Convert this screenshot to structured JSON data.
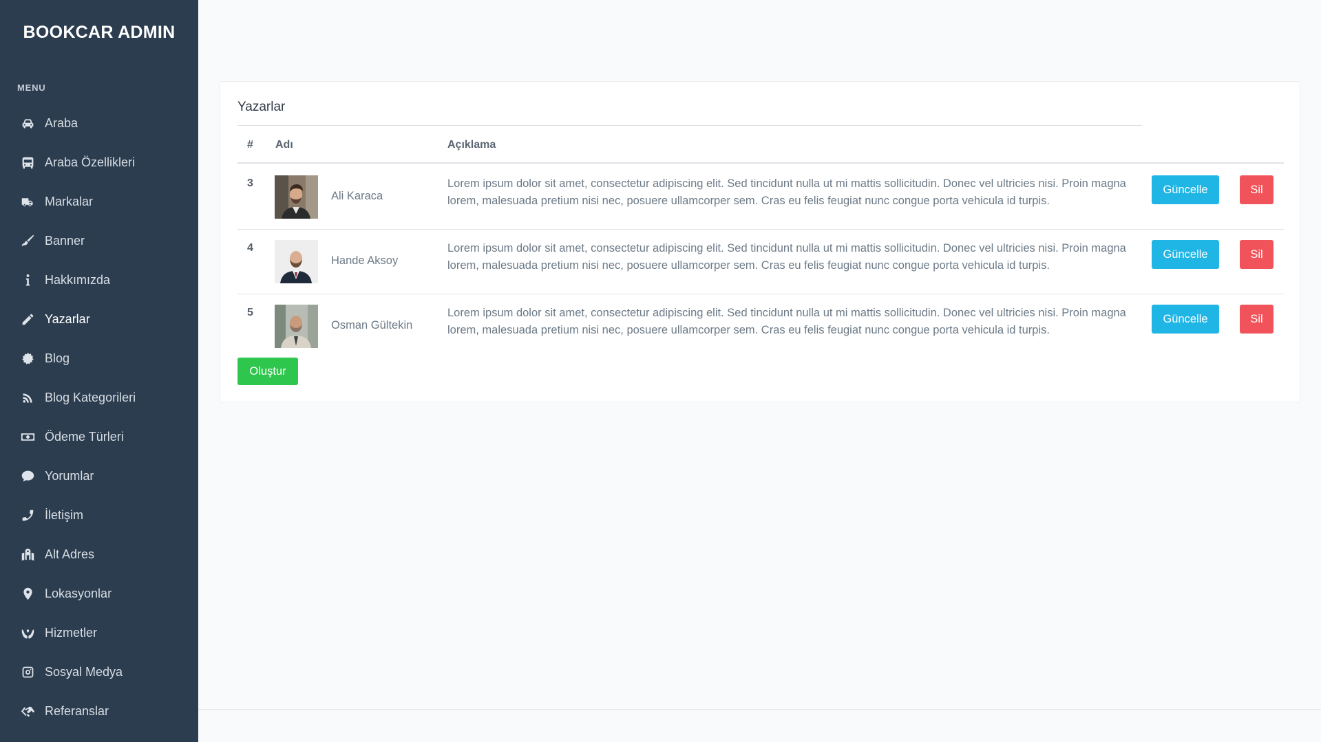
{
  "brand": "BOOKCAR ADMIN",
  "menu_title": "MENU",
  "menu": [
    {
      "label": "Araba",
      "icon": "car-icon"
    },
    {
      "label": "Araba Özellikleri",
      "icon": "bus-icon"
    },
    {
      "label": "Markalar",
      "icon": "truck-icon"
    },
    {
      "label": "Banner",
      "icon": "paint-brush-icon"
    },
    {
      "label": "Hakkımızda",
      "icon": "info-icon"
    },
    {
      "label": "Yazarlar",
      "icon": "pencil-icon",
      "active": true
    },
    {
      "label": "Blog",
      "icon": "gear-badge-icon"
    },
    {
      "label": "Blog Kategorileri",
      "icon": "feed-icon"
    },
    {
      "label": "Ödeme Türleri",
      "icon": "money-icon"
    },
    {
      "label": "Yorumlar",
      "icon": "comment-icon"
    },
    {
      "label": "İletişim",
      "icon": "phone-icon"
    },
    {
      "label": "Alt Adres",
      "icon": "map-icon"
    },
    {
      "label": "Lokasyonlar",
      "icon": "map-marker-icon"
    },
    {
      "label": "Hizmetler",
      "icon": "hands-icon"
    },
    {
      "label": "Sosyal Medya",
      "icon": "instagram-icon"
    },
    {
      "label": "Referanslar",
      "icon": "handshake-icon"
    }
  ],
  "card": {
    "title": "Yazarlar",
    "columns": {
      "num": "#",
      "name": "Adı",
      "desc": "Açıklama"
    },
    "rows": [
      {
        "id": "3",
        "name": "Ali Karaca",
        "description": "Lorem ipsum dolor sit amet, consectetur adipiscing elit. Sed tincidunt nulla ut mi mattis sollicitudin. Donec vel ultricies nisi. Proin magna lorem, malesuada pretium nisi nec, posuere ullamcorper sem. Cras eu felis feugiat nunc congue porta vehicula id turpis."
      },
      {
        "id": "4",
        "name": "Hande Aksoy",
        "description": "Lorem ipsum dolor sit amet, consectetur adipiscing elit. Sed tincidunt nulla ut mi mattis sollicitudin. Donec vel ultricies nisi. Proin magna lorem, malesuada pretium nisi nec, posuere ullamcorper sem. Cras eu felis feugiat nunc congue porta vehicula id turpis."
      },
      {
        "id": "5",
        "name": "Osman Gültekin",
        "description": "Lorem ipsum dolor sit amet, consectetur adipiscing elit. Sed tincidunt nulla ut mi mattis sollicitudin. Donec vel ultricies nisi. Proin magna lorem, malesuada pretium nisi nec, posuere ullamcorper sem. Cras eu felis feugiat nunc congue porta vehicula id turpis."
      }
    ],
    "update_label": "Güncelle",
    "delete_label": "Sil",
    "create_label": "Oluştur"
  },
  "colors": {
    "sidebar": "#2c3d50",
    "update": "#1fb5e4",
    "delete": "#f1535a",
    "create": "#2fc64d"
  }
}
